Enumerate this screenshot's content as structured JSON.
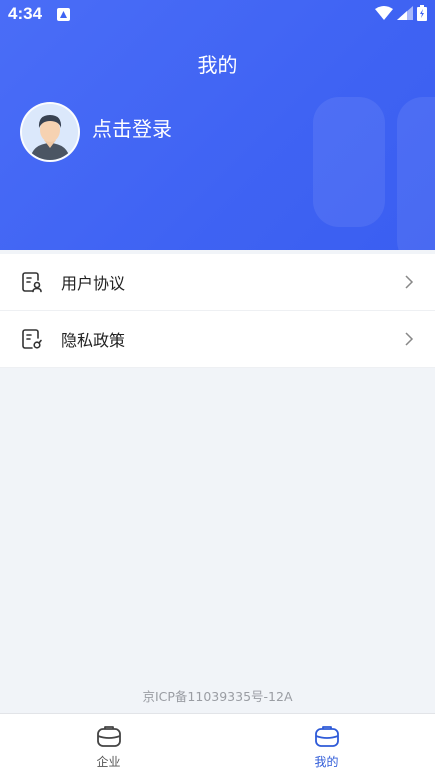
{
  "status_bar": {
    "time": "4:34"
  },
  "header": {
    "title": "我的",
    "login_text": "点击登录"
  },
  "menu": [
    {
      "label": "用户协议",
      "icon": "user-agreement-icon"
    },
    {
      "label": "隐私政策",
      "icon": "privacy-policy-icon"
    }
  ],
  "footer": {
    "icp": "京ICP备11039335号-12A"
  },
  "tabbar": {
    "tabs": [
      {
        "label": "企业",
        "icon": "briefcase-icon",
        "active": false
      },
      {
        "label": "我的",
        "icon": "briefcase-icon",
        "active": true
      }
    ]
  },
  "colors": {
    "brand": "#3f63f3",
    "active_tab": "#2f5bd8",
    "inactive_tab": "#555555"
  }
}
